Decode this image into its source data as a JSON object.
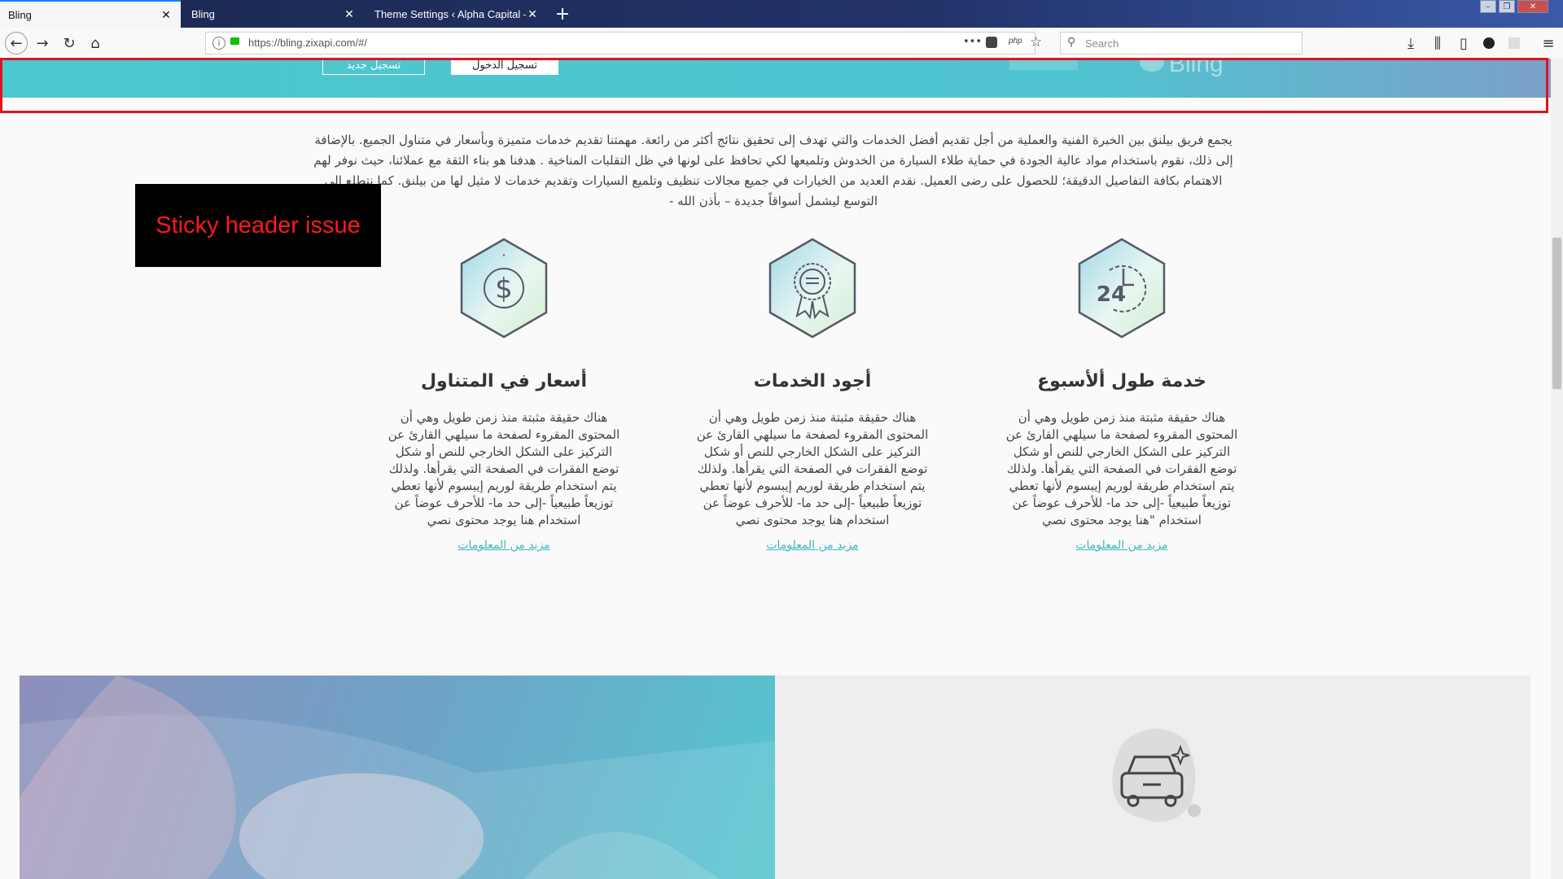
{
  "browser": {
    "tabs": [
      {
        "label": "Bling",
        "active": true
      },
      {
        "label": "Bling",
        "active": false
      },
      {
        "label": "Theme Settings ‹ Alpha Capital — W",
        "active": false
      }
    ],
    "new_tab": "+",
    "url": "https://bling.zixapi.com/#/",
    "search_placeholder": "Search",
    "php_badge": "php",
    "more_icon": "•••"
  },
  "header": {
    "login_label": "تسجيل الدخول",
    "register_label": "تسجيل جديد",
    "logo_text": "Bling"
  },
  "intro": {
    "line1": "يجمع فريق بيلنق بين الخبرة الفنية والعملية من أجل تقديم أفضل الخدمات والتي تهدف إلى تحقيق نتائج أكثر من رائعة. مهمتنا تقديم خدمات متميزة وبأسعار في متناول الجميع. بالإضافة",
    "line2": "إلى ذلك، نقوم باستخدام مواد عالية الجودة في حماية طلاء السيارة من الخدوش وتلميعها لكي تحافظ على لونها في ظل التقلبات المناخية . هدفنا هو بناء الثقة مع عملائنا، حيث نوفر لهم",
    "line3": "الاهتمام بكافة التفاصيل الدقيقة؛ للحصول على رضى العميل. نقدم العديد من الخيارات في جميع مجالات تنظيف وتلميع السيارات وتقديم خدمات لا مثيل لها من بيلنق. كما نتطلع إلى",
    "line4": "التوسع ليشمل أسواقاً جديدة – بأذن الله -"
  },
  "annotation": "Sticky header issue",
  "features": [
    {
      "icon": "dollar-icon",
      "title": "أسعار في المتناول",
      "body": "هناك حقيقة مثبتة منذ زمن طويل وهي أن المحتوى المقروء لصفحة ما سيلهي القارئ عن التركيز على الشكل الخارجي للنص أو شكل توضع الفقرات في الصفحة التي يقرأها. ولذلك يتم استخدام طريقة لوريم إيبسوم لأنها تعطي توزيعاً طبيعياً -إلى حد ما- للأحرف عوضاً عن استخدام هنا يوجد محتوى نصي",
      "link": "مزيد من المعلومات"
    },
    {
      "icon": "award-badge-icon",
      "title": "أجود الخدمات",
      "body": "هناك حقيقة مثبتة منذ زمن طويل وهي أن المحتوى المقروء لصفحة ما سيلهي القارئ عن التركيز على الشكل الخارجي للنص أو شكل توضع الفقرات في الصفحة التي يقرأها. ولذلك يتم استخدام طريقة لوريم إيبسوم لأنها تعطي توزيعاً طبيعياً -إلى حد ما- للأحرف عوضاً عن استخدام هنا يوجد محتوى نصي",
      "link": "مزيد من المعلومات"
    },
    {
      "icon": "24-hour-icon",
      "title": "خدمة طول ألأسبوع",
      "body": "هناك حقيقة مثبتة منذ زمن طويل وهي أن المحتوى المقروء لصفحة ما سيلهي القارئ عن التركيز على الشكل الخارجي للنص أو شكل توضع الفقرات في الصفحة التي يقرأها. ولذلك يتم استخدام طريقة لوريم إيبسوم لأنها تعطي توزيعاً طبيعياً -إلى حد ما- للأحرف عوضاً عن استخدام \"هنا يوجد محتوى نصي",
      "link": "مزيد من المعلومات"
    }
  ],
  "colors": {
    "accent": "#41b6c6",
    "header_start": "#4cc8cf",
    "annotation_red": "#e0141e"
  }
}
